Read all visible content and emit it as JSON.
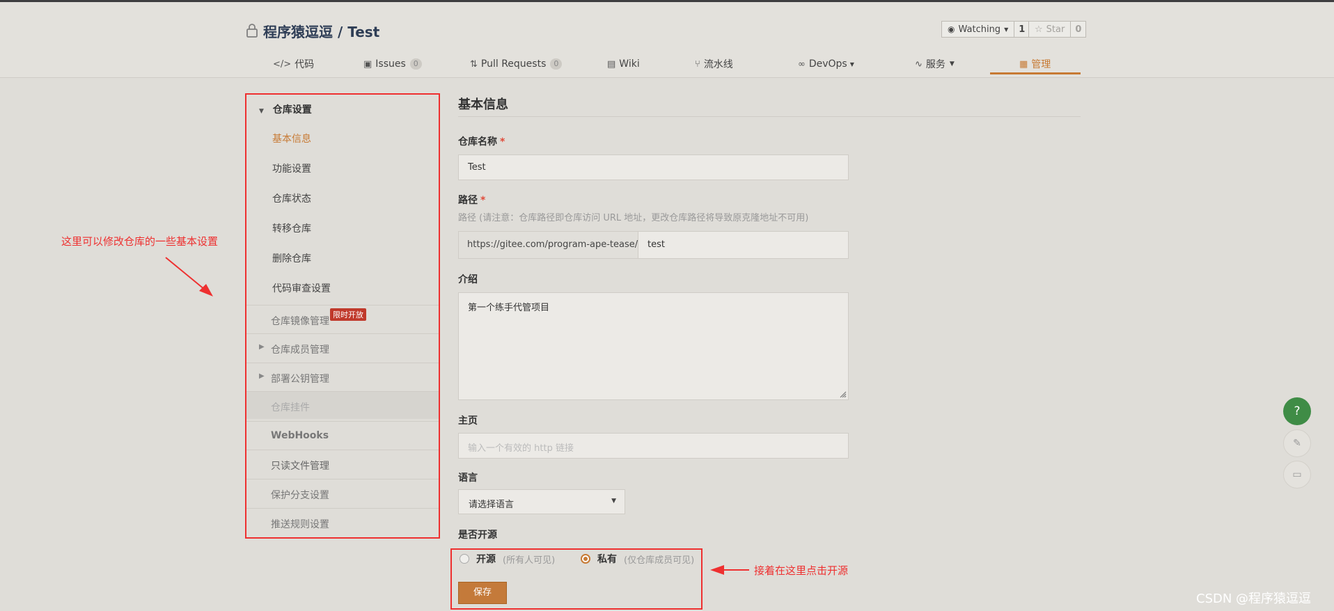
{
  "repo": {
    "owner": "程序猿逗逗",
    "separator": "/",
    "name": "Test"
  },
  "watch": {
    "label": "Watching",
    "count": "1"
  },
  "star": {
    "label": "Star",
    "count": "0"
  },
  "tabs": [
    {
      "label": "代码",
      "icon": "code-icon"
    },
    {
      "label": "Issues",
      "badge": "0",
      "icon": "issues-icon"
    },
    {
      "label": "Pull Requests",
      "badge": "0",
      "icon": "pull-request-icon"
    },
    {
      "label": "Wiki",
      "icon": "wiki-icon"
    },
    {
      "label": "流水线",
      "icon": "pipeline-icon"
    },
    {
      "label": "DevOps",
      "icon": "devops-icon"
    },
    {
      "label": "服务",
      "icon": "service-icon"
    },
    {
      "label": "管理",
      "icon": "manage-icon",
      "active": true
    }
  ],
  "sidebar": {
    "group_title": "仓库设置",
    "sub_items": [
      "基本信息",
      "功能设置",
      "仓库状态",
      "转移仓库",
      "删除仓库",
      "代码审查设置"
    ],
    "items": [
      "仓库镜像管理",
      "仓库成员管理",
      "部署公钥管理",
      "仓库挂件",
      "WebHooks",
      "只读文件管理",
      "保护分支设置",
      "推送规则设置"
    ],
    "mirror_tag": "限时开放"
  },
  "form": {
    "section_title": "基本信息",
    "name_label": "仓库名称",
    "required_mark": "*",
    "name_value": "Test",
    "path_label": "路径",
    "path_hint": "路径 (请注意：仓库路径即仓库访问 URL 地址，更改仓库路径将导致原克隆地址不可用)",
    "path_prefix": "https://gitee.com/program-ape-tease/",
    "path_value": "test",
    "intro_label": "介绍",
    "intro_value": "第一个练手代管项目",
    "homepage_label": "主页",
    "homepage_placeholder": "输入一个有效的 http 链接",
    "language_label": "语言",
    "language_value": "请选择语言",
    "opensource_label": "是否开源",
    "radio_public": "开源",
    "radio_public_hint": "(所有人可见)",
    "radio_private": "私有",
    "radio_private_hint": "(仅仓库成员可见)",
    "save_label": "保存"
  },
  "annotations": {
    "left": "这里可以修改仓库的一些基本设置",
    "right": "接着在这里点击开源"
  },
  "colors": {
    "accent": "#c77a34",
    "annotation": "#ee3030",
    "help": "#3f8c46"
  },
  "watermark": "CSDN @程序猿逗逗"
}
